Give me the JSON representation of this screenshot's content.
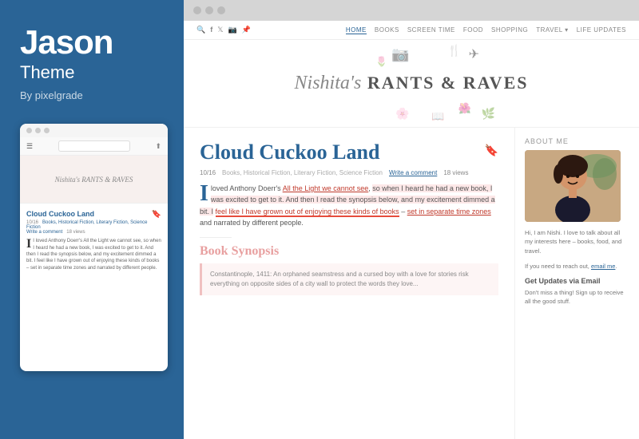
{
  "left": {
    "theme_name": "Jason",
    "theme_label": "Theme",
    "theme_by": "By pixelgrade"
  },
  "browser": {
    "dots": [
      "dot1",
      "dot2",
      "dot3"
    ]
  },
  "blog_nav": {
    "social_icons": [
      "search",
      "f",
      "twitter",
      "instagram",
      "pinterest"
    ],
    "menu_items": [
      {
        "label": "HOME",
        "active": true
      },
      {
        "label": "BOOKS",
        "active": false
      },
      {
        "label": "SCREEN TIME",
        "active": false
      },
      {
        "label": "FOOD",
        "active": false
      },
      {
        "label": "SHOPPING",
        "active": false
      },
      {
        "label": "TRAVEL",
        "active": false
      },
      {
        "label": "LIFE UPDATES",
        "active": false
      }
    ]
  },
  "blog_header": {
    "title_italic": "Nishita's",
    "title_main": " RANTS & RAVES"
  },
  "article": {
    "title": "Cloud Cuckoo Land",
    "meta_date": "10/16",
    "meta_categories": "Books, Historical Fiction, Literary Fiction, Science Fiction",
    "meta_comment": "Write a comment",
    "meta_views": "18 views",
    "body_part1": "loved Anthony Doerr's ",
    "body_link1": "All the Light we cannot see",
    "body_part2": ", so when I heard he had a new book, I was excited to get to it. And then I read the synopsis below, and my excitement dimmed a bit. I ",
    "body_link2": "feel like I have grown out of enjoying these kinds of books",
    "body_part3": " – ",
    "body_link3": "set in separate time zones",
    "body_part4": " and narrated by different people.",
    "divider": true,
    "section_title": "Book Synopsis",
    "blockquote_text": "Constantinople, 1411: An orphaned seamstress and a cursed boy with a love for stories risk everything on opposite sides of a city wall to protect the words they love..."
  },
  "sidebar": {
    "about_title": "About me",
    "about_text": "Hi, I am Nishi. I love to talk about all my interests here – books, food, and travel.",
    "about_contact": "If you need to reach out, email me.",
    "updates_title": "Get Updates via Email",
    "updates_text": "Don't miss a thing! Sign up to receive all the good stuff."
  },
  "mobile": {
    "article_title": "Cloud Cuckoo Land",
    "meta": "10/16",
    "categories": "Books, Historical Fiction, Literary Fiction, Science Fiction",
    "comment": "Write a comment",
    "views": "18 views",
    "body": "I loved Anthony Doerr's All the Light we cannot see, so when I heard he had a new book, I was excited to get to it. And then I read the synopsis below, and my excitement dimmed a bit. I feel like I have grown out of enjoying these kinds of books – set in separate time zones and narrated by different people."
  },
  "colors": {
    "accent": "#2a6496",
    "left_bg": "#2a6496",
    "red_highlight": "#e74c3c",
    "section_pink": "#e8a0a0"
  }
}
